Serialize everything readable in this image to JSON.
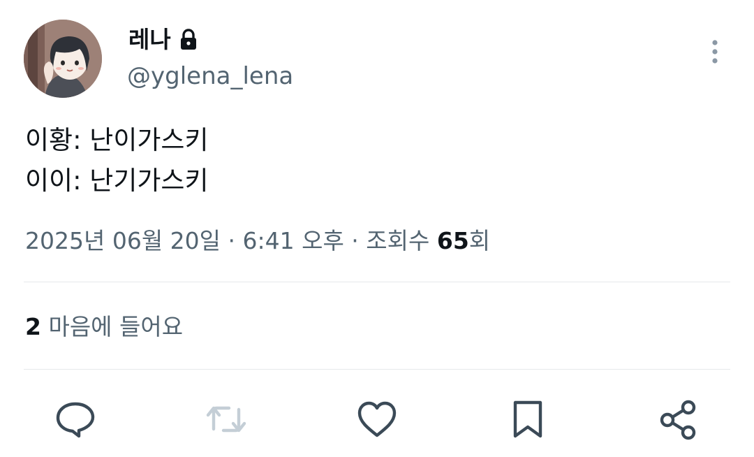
{
  "author": {
    "display_name": "레나",
    "handle": "@yglena_lena",
    "protected_icon": "lock-icon",
    "avatar": "cartoon-character-avatar"
  },
  "menu_icon": "more-vertical-icon",
  "tweet": {
    "lines": [
      "이황: 난이가스키",
      "이이: 난기가스키"
    ]
  },
  "meta": {
    "timestamp": "2025년 06월 20일 · 6:41 오후 · 조회수 ",
    "views_count": "65",
    "views_suffix": "회"
  },
  "engagement": {
    "likes_count": "2",
    "likes_label": " 마음에 들어요"
  },
  "actions": [
    "reply-icon",
    "retweet-icon",
    "like-icon",
    "bookmark-icon",
    "share-icon"
  ],
  "colors": {
    "text": "#0f1419",
    "secondary": "#536471",
    "divider": "#e6e9eb",
    "retweet_disabled": "#c4ced6"
  }
}
